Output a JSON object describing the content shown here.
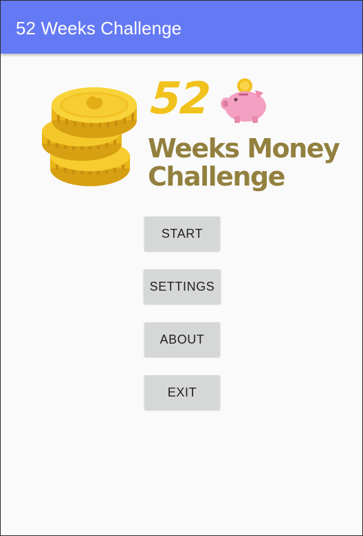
{
  "app_bar": {
    "title": "52 Weeks Challenge",
    "color": "#6479f4"
  },
  "logo": {
    "number": "52",
    "line1": "Weeks Money",
    "line2": "Challenge",
    "number_color": "#f1c21c",
    "text_color": "#92803f",
    "icons": [
      "gold-coins-stack-icon",
      "piggy-bank-icon"
    ]
  },
  "menu": {
    "start": "START",
    "settings": "SETTINGS",
    "about": "ABOUT",
    "exit": "EXIT"
  },
  "colors": {
    "background": "#fafafa",
    "button": "#d6d7d7",
    "button_text": "#1f1f1f"
  }
}
